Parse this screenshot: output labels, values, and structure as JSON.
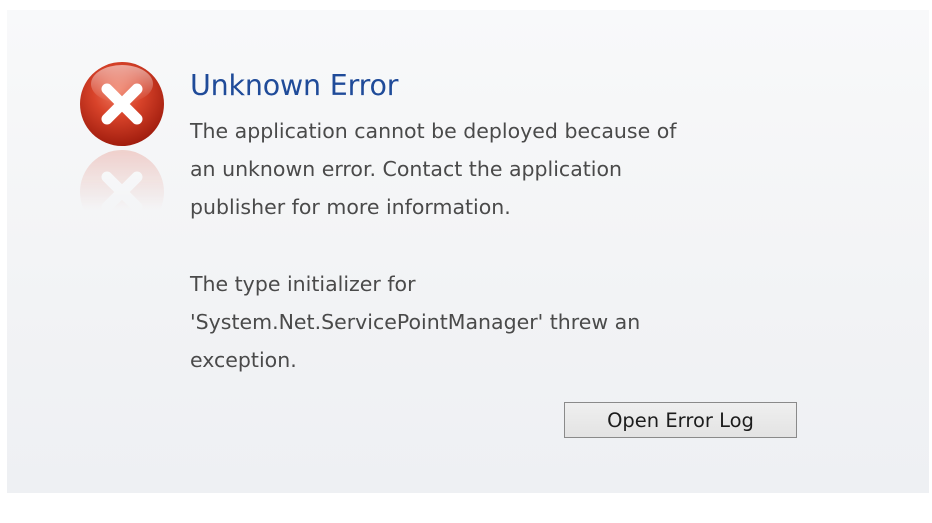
{
  "dialog": {
    "title": "Unknown Error",
    "icon": "error-icon",
    "message_lines": [
      "The application cannot be deployed because of",
      "an unknown error. Contact the application",
      "publisher for more information."
    ],
    "detail_lines": [
      "The type initializer for",
      "'System.Net.ServicePointManager' threw an",
      "exception."
    ],
    "button_label": "Open Error Log"
  },
  "colors": {
    "title": "#1f4b99",
    "text": "#4a4a4a",
    "icon_red": "#c9311b",
    "background": "#f4f5f7"
  }
}
